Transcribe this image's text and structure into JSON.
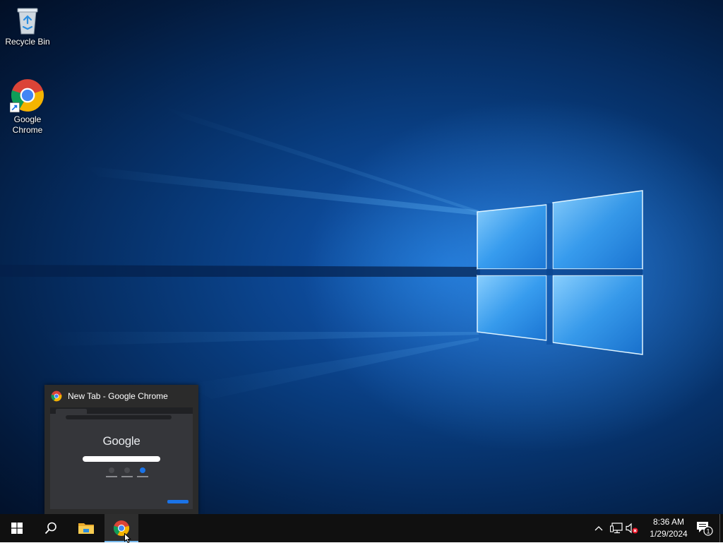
{
  "desktop": {
    "icons": [
      {
        "label": "Recycle Bin",
        "icon": "recycle-bin-icon"
      },
      {
        "label": "Google Chrome",
        "label_line1": "Google",
        "label_line2": "Chrome",
        "icon": "chrome-icon"
      }
    ]
  },
  "preview": {
    "title": "New Tab - Google Chrome",
    "thumbnail": {
      "logo_text": "Google"
    }
  },
  "taskbar": {
    "buttons": [
      {
        "name": "start",
        "icon": "windows-logo-icon"
      },
      {
        "name": "search",
        "icon": "search-icon"
      },
      {
        "name": "file-explorer",
        "icon": "folder-icon"
      },
      {
        "name": "google-chrome",
        "icon": "chrome-icon",
        "active": true
      }
    ],
    "tray": {
      "icons": [
        "chevron-up-icon",
        "network-icon",
        "volume-muted-icon"
      ],
      "time": "8:36 AM",
      "date": "1/29/2024",
      "notification_count": "1"
    }
  },
  "colors": {
    "taskbar": "#101010",
    "active_indicator": "#76b9ed",
    "wallpaper_glow": "#4fb3ff"
  }
}
